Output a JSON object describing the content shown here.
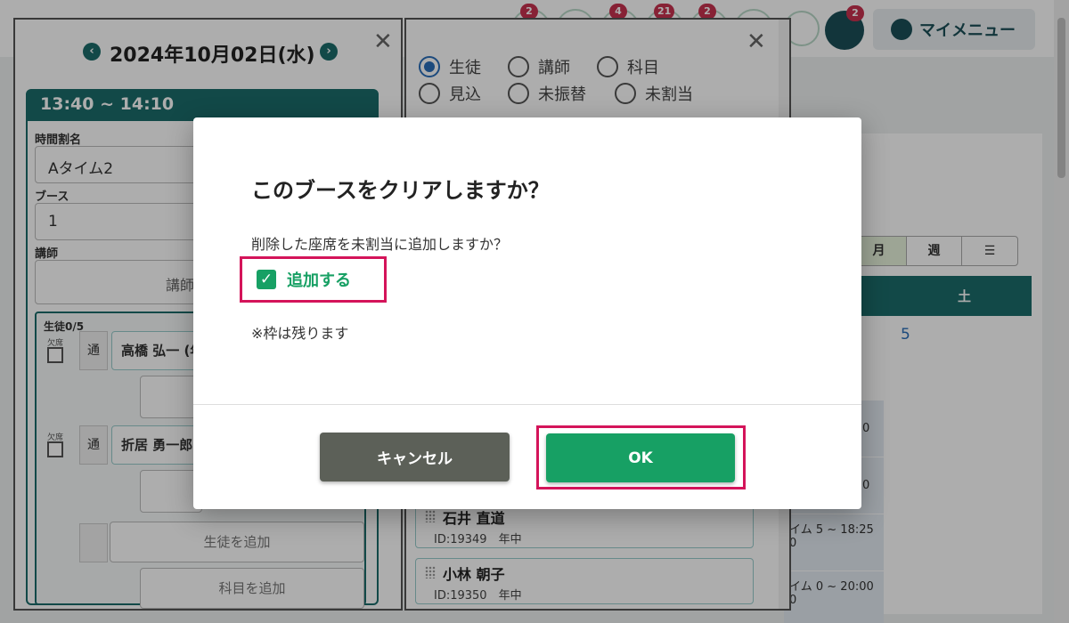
{
  "topbar": {
    "badges": [
      "2",
      "4",
      "21",
      "2"
    ],
    "chat_badge": "2",
    "mymenu_label": "マイメニュー"
  },
  "left_panel": {
    "date": "2024年10月02日(水)",
    "time_range": "13:40 ~ 14:10",
    "timetable_label": "時間割名",
    "timetable_value": "Aタイム2",
    "booth_label": "ブース",
    "booth_value": "1",
    "teacher_label": "講師",
    "teacher_placeholder": "講師",
    "students_title": "生徒0/5",
    "absent_label": "欠席",
    "students": [
      {
        "type": "通",
        "name": "高橋 弘一 (年"
      },
      {
        "type": "通",
        "name": "折居 勇一郎"
      }
    ],
    "add_student": "生徒を追加",
    "add_subject": "科目を追加"
  },
  "mid_panel": {
    "radios": [
      {
        "label": "生徒",
        "checked": true
      },
      {
        "label": "講師",
        "checked": false
      },
      {
        "label": "科目",
        "checked": false
      },
      {
        "label": "見込",
        "checked": false
      },
      {
        "label": "未振替",
        "checked": false
      },
      {
        "label": "未割当",
        "checked": false
      }
    ],
    "cards": [
      {
        "name": "石井 直道",
        "sub": "ID:19349　年中"
      },
      {
        "name": "小林 朝子",
        "sub": "ID:19350　年中"
      }
    ]
  },
  "calendar": {
    "views": [
      "月",
      "週",
      "☰"
    ],
    "sat_label": "土",
    "date_5": "5",
    "slots": [
      {
        "text": "0"
      },
      {
        "text": "0"
      },
      {
        "text": "イム  5 ~ 18:25  0"
      },
      {
        "text": "イム  0 ~ 20:00  0"
      }
    ]
  },
  "modal": {
    "title": "このブースをクリアしますか？",
    "message": "削除した座席を未割当に追加しますか？",
    "checkbox_label": "追加する",
    "checkbox_checked": true,
    "note": "※枠は残ります",
    "cancel_label": "キャンセル",
    "ok_label": "OK",
    "highlight_color": "#d4145a",
    "ok_color": "#17a064",
    "cancel_color": "#5c6058"
  }
}
